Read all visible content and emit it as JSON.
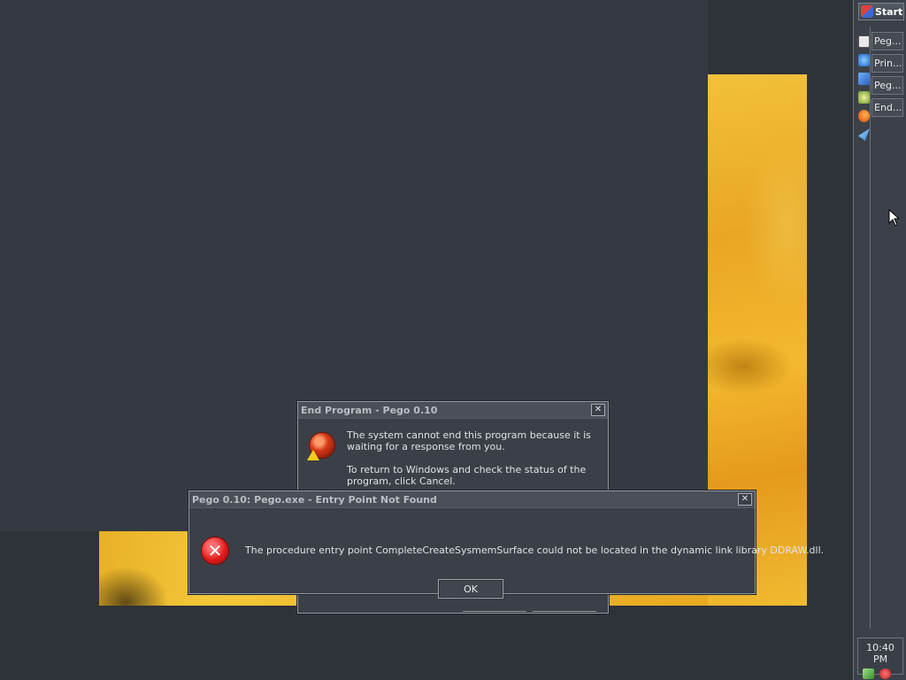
{
  "taskbar": {
    "start_label": "Start",
    "tasks": [
      "Peg...",
      "Prin...",
      "Peg...",
      "End..."
    ],
    "clock": "10:40 PM",
    "quick_launch_icons": [
      "notepad-icon",
      "ie-icon",
      "media-icon",
      "music-icon",
      "firefox-icon",
      "messenger-icon"
    ],
    "tray_icons": [
      "network-icon",
      "security-alert-icon"
    ]
  },
  "end_program_dialog": {
    "title": "End Program - Pego 0.10",
    "message_1": "The system cannot end this program because it is waiting for a response from you.",
    "message_2": "To return to Windows and check the status of the program, click Cancel."
  },
  "entry_point_dialog": {
    "title": "Pego 0.10: Pego.exe - Entry Point Not Found",
    "message": "The procedure entry point CompleteCreateSysmemSurface could not be located in the dynamic link library DDRAW.dll.",
    "ok_label": "OK"
  },
  "colors": {
    "desktop": "#2e3239",
    "dialog_bg": "#3b4048",
    "wallpaper_accent": "#f2c13a",
    "error_red": "#e11b1b"
  }
}
